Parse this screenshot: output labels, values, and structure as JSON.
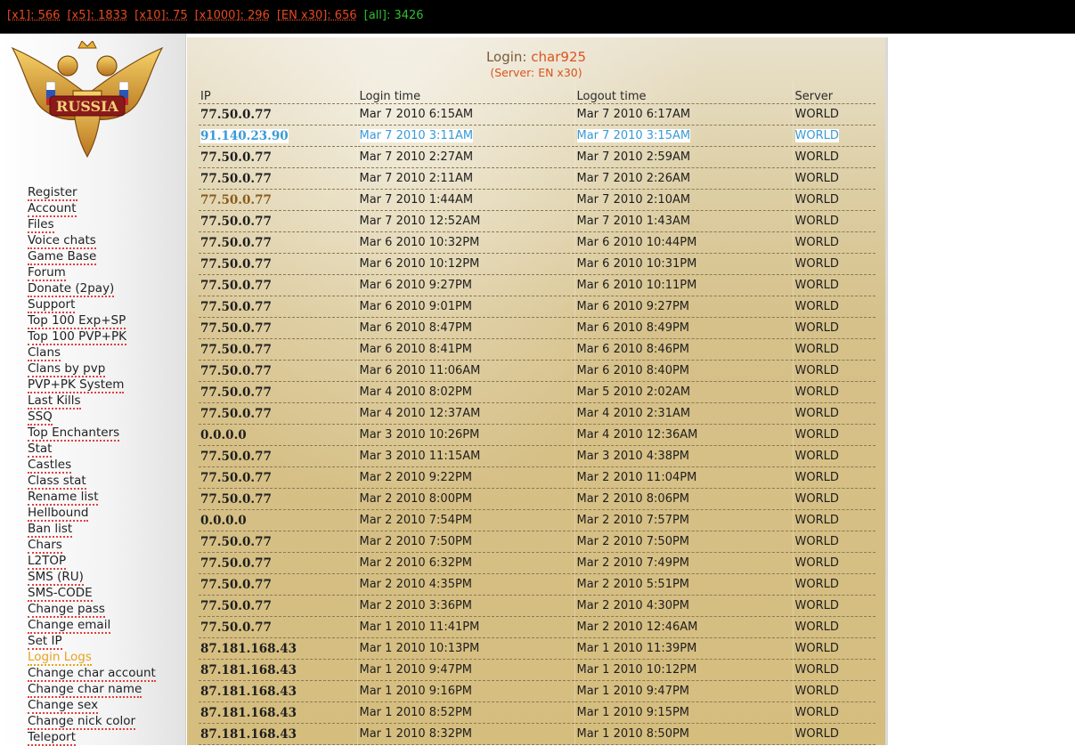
{
  "stats": [
    {
      "label": "[x1]: 566",
      "kind": "server"
    },
    {
      "label": "[x5]: 1833",
      "kind": "server"
    },
    {
      "label": "[x10]: 75",
      "kind": "server"
    },
    {
      "label": "[x1000]: 296",
      "kind": "server"
    },
    {
      "label": "[EN x30]: 656",
      "kind": "server"
    },
    {
      "label": "[all]: 3426",
      "kind": "all"
    }
  ],
  "logo": {
    "text": "RUSSIA"
  },
  "nav": {
    "active": "Login Logs",
    "items": [
      "Register",
      "Account",
      "Files",
      "Voice chats",
      "Game Base",
      "Forum",
      "Donate (2pay)",
      "Support",
      "Top 100 Exp+SP",
      "Top 100 PVP+PK",
      "Clans",
      "Clans by pvp",
      "PVP+PK System",
      "Last Kills",
      "SSQ",
      "Top Enchanters",
      "Stat",
      "Castles",
      "Class stat",
      "Rename list",
      "Hellbound",
      "Ban list",
      "Chars",
      "L2TOP",
      "SMS (RU)",
      "SMS-CODE",
      "Change pass",
      "Change email",
      "Set IP",
      "Login Logs",
      "Change char account",
      "Change char name",
      "Change sex",
      "Change nick color",
      "Teleport"
    ]
  },
  "header": {
    "login_label": "Login:",
    "char_name": "char925",
    "server_line": "(Server: EN x30)"
  },
  "table": {
    "columns": [
      "IP",
      "Login time",
      "Logout time",
      "Server"
    ],
    "rows": [
      {
        "ip": "77.50.0.77",
        "login": "Mar 7 2010 6:15AM",
        "logout": "Mar 7 2010 6:17AM",
        "server": "WORLD"
      },
      {
        "ip": "91.140.23.90",
        "login": "Mar 7 2010 3:11AM",
        "logout": "Mar 7 2010 3:15AM",
        "server": "WORLD",
        "state": "sel"
      },
      {
        "ip": "77.50.0.77",
        "login": "Mar 7 2010 2:27AM",
        "logout": "Mar 7 2010 2:59AM",
        "server": "WORLD"
      },
      {
        "ip": "77.50.0.77",
        "login": "Mar 7 2010 2:11AM",
        "logout": "Mar 7 2010 2:26AM",
        "server": "WORLD"
      },
      {
        "ip": "77.50.0.77",
        "login": "Mar 7 2010 1:44AM",
        "logout": "Mar 7 2010 2:10AM",
        "server": "WORLD",
        "state": "hl"
      },
      {
        "ip": "77.50.0.77",
        "login": "Mar 7 2010 12:52AM",
        "logout": "Mar 7 2010 1:43AM",
        "server": "WORLD"
      },
      {
        "ip": "77.50.0.77",
        "login": "Mar 6 2010 10:32PM",
        "logout": "Mar 6 2010 10:44PM",
        "server": "WORLD"
      },
      {
        "ip": "77.50.0.77",
        "login": "Mar 6 2010 10:12PM",
        "logout": "Mar 6 2010 10:31PM",
        "server": "WORLD"
      },
      {
        "ip": "77.50.0.77",
        "login": "Mar 6 2010 9:27PM",
        "logout": "Mar 6 2010 10:11PM",
        "server": "WORLD"
      },
      {
        "ip": "77.50.0.77",
        "login": "Mar 6 2010 9:01PM",
        "logout": "Mar 6 2010 9:27PM",
        "server": "WORLD"
      },
      {
        "ip": "77.50.0.77",
        "login": "Mar 6 2010 8:47PM",
        "logout": "Mar 6 2010 8:49PM",
        "server": "WORLD"
      },
      {
        "ip": "77.50.0.77",
        "login": "Mar 6 2010 8:41PM",
        "logout": "Mar 6 2010 8:46PM",
        "server": "WORLD"
      },
      {
        "ip": "77.50.0.77",
        "login": "Mar 6 2010 11:06AM",
        "logout": "Mar 6 2010 8:40PM",
        "server": "WORLD"
      },
      {
        "ip": "77.50.0.77",
        "login": "Mar 4 2010 8:02PM",
        "logout": "Mar 5 2010 2:02AM",
        "server": "WORLD"
      },
      {
        "ip": "77.50.0.77",
        "login": "Mar 4 2010 12:37AM",
        "logout": "Mar 4 2010 2:31AM",
        "server": "WORLD"
      },
      {
        "ip": "0.0.0.0",
        "login": "Mar 3 2010 10:26PM",
        "logout": "Mar 4 2010 12:36AM",
        "server": "WORLD"
      },
      {
        "ip": "77.50.0.77",
        "login": "Mar 3 2010 11:15AM",
        "logout": "Mar 3 2010 4:38PM",
        "server": "WORLD"
      },
      {
        "ip": "77.50.0.77",
        "login": "Mar 2 2010 9:22PM",
        "logout": "Mar 2 2010 11:04PM",
        "server": "WORLD"
      },
      {
        "ip": "77.50.0.77",
        "login": "Mar 2 2010 8:00PM",
        "logout": "Mar 2 2010 8:06PM",
        "server": "WORLD"
      },
      {
        "ip": "0.0.0.0",
        "login": "Mar 2 2010 7:54PM",
        "logout": "Mar 2 2010 7:57PM",
        "server": "WORLD"
      },
      {
        "ip": "77.50.0.77",
        "login": "Mar 2 2010 7:50PM",
        "logout": "Mar 2 2010 7:50PM",
        "server": "WORLD"
      },
      {
        "ip": "77.50.0.77",
        "login": "Mar 2 2010 6:32PM",
        "logout": "Mar 2 2010 7:49PM",
        "server": "WORLD"
      },
      {
        "ip": "77.50.0.77",
        "login": "Mar 2 2010 4:35PM",
        "logout": "Mar 2 2010 5:51PM",
        "server": "WORLD"
      },
      {
        "ip": "77.50.0.77",
        "login": "Mar 2 2010 3:36PM",
        "logout": "Mar 2 2010 4:30PM",
        "server": "WORLD"
      },
      {
        "ip": "77.50.0.77",
        "login": "Mar 1 2010 11:41PM",
        "logout": "Mar 2 2010 12:46AM",
        "server": "WORLD"
      },
      {
        "ip": "87.181.168.43",
        "login": "Mar 1 2010 10:13PM",
        "logout": "Mar 1 2010 11:39PM",
        "server": "WORLD"
      },
      {
        "ip": "87.181.168.43",
        "login": "Mar 1 2010 9:47PM",
        "logout": "Mar 1 2010 10:12PM",
        "server": "WORLD"
      },
      {
        "ip": "87.181.168.43",
        "login": "Mar 1 2010 9:16PM",
        "logout": "Mar 1 2010 9:47PM",
        "server": "WORLD"
      },
      {
        "ip": "87.181.168.43",
        "login": "Mar 1 2010 8:52PM",
        "logout": "Mar 1 2010 9:15PM",
        "server": "WORLD"
      },
      {
        "ip": "87.181.168.43",
        "login": "Mar 1 2010 8:32PM",
        "logout": "Mar 1 2010 8:50PM",
        "server": "WORLD"
      }
    ]
  }
}
